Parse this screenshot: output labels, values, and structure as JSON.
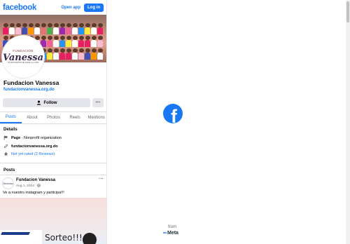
{
  "header": {
    "logo": "facebook",
    "open_app": "Open app",
    "login": "Log in"
  },
  "profile": {
    "avatar_small": "FUNDACIÓN",
    "avatar_big": "Vanessa",
    "avatar_tagline": "UN MOVIMIENTO DE AMOR A LA VIDA",
    "name": "Fundacion Vanessa",
    "url": "fundacionvanessa.org.do",
    "follow": "Follow",
    "more": "···"
  },
  "tabs": [
    "Posts",
    "About",
    "Photos",
    "Reels",
    "Mentions"
  ],
  "details": {
    "heading": "Details",
    "page_label": "Page",
    "page_category": " · Nonprofit organization",
    "website": "fundacionvanessa.org.do",
    "rating": "Not yet rated (2 Reviews)"
  },
  "posts": {
    "heading": "Posts",
    "author": "Fundacion Vanessa",
    "date": "Aug 1, 2024 · ",
    "avatar_text": "Vanessa",
    "more": "···",
    "text": "Ve a nuestro instagram y participa!!!",
    "image_text": "Sorteo!!!"
  },
  "splash": {
    "from": "from",
    "meta": "Meta"
  },
  "colors": {
    "brand": "#1877f2",
    "text": "#050505",
    "muted": "#65676b",
    "button_bg": "#e4e6eb"
  }
}
